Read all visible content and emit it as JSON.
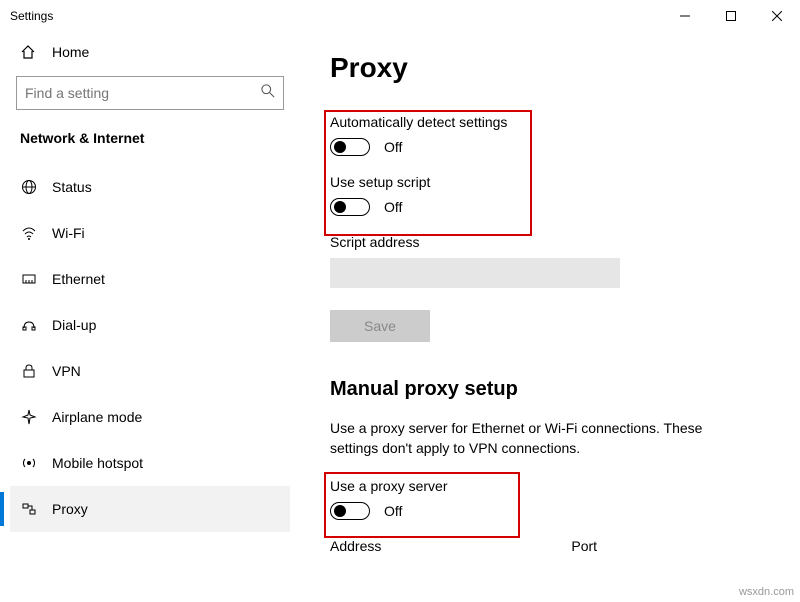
{
  "window": {
    "title": "Settings"
  },
  "sidebar": {
    "home": "Home",
    "search_placeholder": "Find a setting",
    "section": "Network & Internet",
    "items": [
      {
        "label": "Status"
      },
      {
        "label": "Wi-Fi"
      },
      {
        "label": "Ethernet"
      },
      {
        "label": "Dial-up"
      },
      {
        "label": "VPN"
      },
      {
        "label": "Airplane mode"
      },
      {
        "label": "Mobile hotspot"
      },
      {
        "label": "Proxy"
      }
    ]
  },
  "proxy": {
    "heading": "Proxy",
    "auto_detect_label": "Automatically detect settings",
    "auto_detect_state": "Off",
    "setup_script_label": "Use setup script",
    "setup_script_state": "Off",
    "script_address_label": "Script address",
    "save_label": "Save",
    "manual_heading": "Manual proxy setup",
    "manual_desc": "Use a proxy server for Ethernet or Wi-Fi connections. These settings don't apply to VPN connections.",
    "use_proxy_label": "Use a proxy server",
    "use_proxy_state": "Off",
    "address_label": "Address",
    "port_label": "Port"
  },
  "watermark": "wsxdn.com"
}
